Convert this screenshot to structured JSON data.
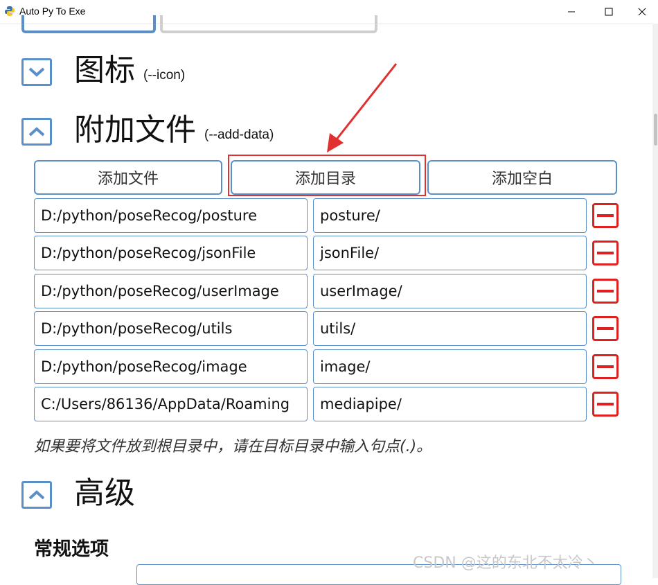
{
  "window": {
    "title": "Auto Py To Exe"
  },
  "sections": {
    "icon": {
      "title": "图标",
      "flag": "(--icon)"
    },
    "add_data": {
      "title": "附加文件",
      "flag": "(--add-data)"
    },
    "advanced": {
      "title": "高级"
    }
  },
  "add_data": {
    "buttons": {
      "add_files": "添加文件",
      "add_folder": "添加目录",
      "add_blank": "添加空白"
    },
    "rows": [
      {
        "source": "D:/python/poseRecog/posture",
        "dest": "posture/"
      },
      {
        "source": "D:/python/poseRecog/jsonFile",
        "dest": "jsonFile/"
      },
      {
        "source": "D:/python/poseRecog/userImage",
        "dest": "userImage/"
      },
      {
        "source": "D:/python/poseRecog/utils",
        "dest": "utils/"
      },
      {
        "source": "D:/python/poseRecog/image",
        "dest": "image/"
      },
      {
        "source": "C:/Users/86136/AppData/Roaming",
        "dest": "mediapipe/"
      }
    ],
    "hint": "如果要将文件放到根目录中，请在目标目录中输入句点(.)。"
  },
  "advanced": {
    "general_options": "常规选项"
  },
  "watermark": "CSDN @这的东北不太冷丶",
  "colors": {
    "accent": "#5b8fc7",
    "remove": "#e0201e",
    "annotation": "#e03030"
  },
  "icons": [
    "python-icon",
    "minimize-icon",
    "maximize-icon",
    "close-icon",
    "chevron-down-icon",
    "chevron-up-icon",
    "minus-icon",
    "arrow-annotation"
  ]
}
